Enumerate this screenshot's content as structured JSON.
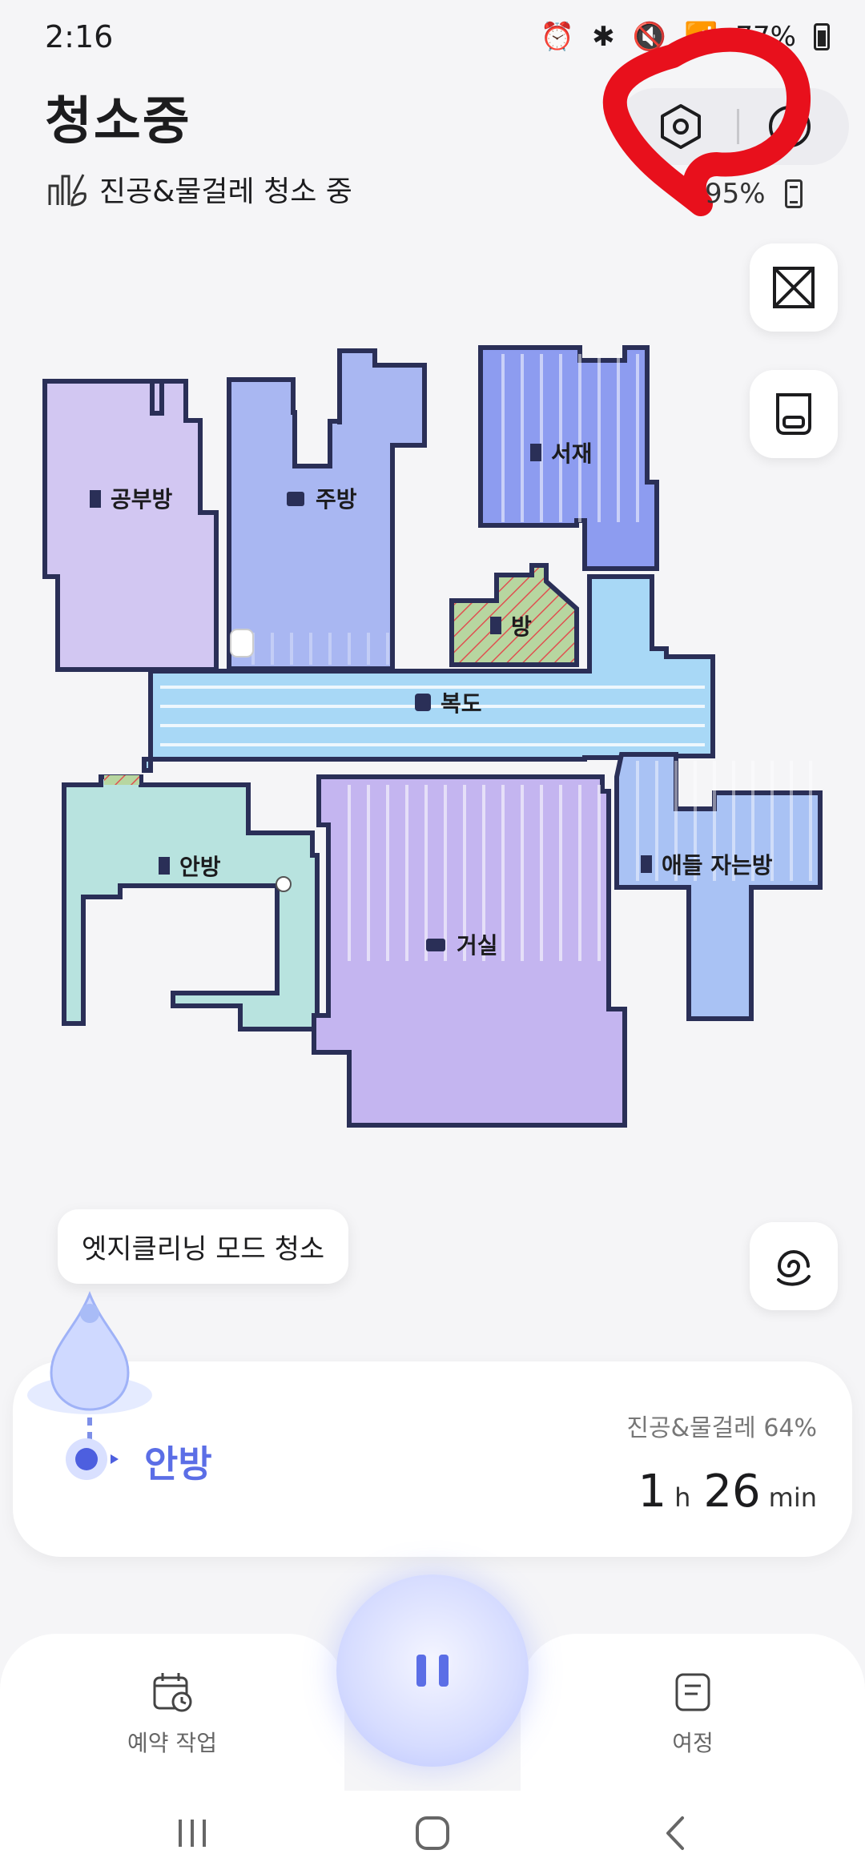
{
  "status_bar": {
    "time": "2:16",
    "battery_text": "77%"
  },
  "header": {
    "title": "청소중",
    "subtitle": "진공&물걸레 청소 중",
    "battery_percent": "95%"
  },
  "map": {
    "rooms": [
      {
        "key": "study",
        "label": "공부방"
      },
      {
        "key": "kitchen",
        "label": "주방"
      },
      {
        "key": "library",
        "label": "서재"
      },
      {
        "key": "room",
        "label": "방"
      },
      {
        "key": "hallway",
        "label": "복도"
      },
      {
        "key": "master",
        "label": "안방"
      },
      {
        "key": "living",
        "label": "거실"
      },
      {
        "key": "kids",
        "label": "애들 자는방"
      }
    ]
  },
  "tooltip": "엣지클리닝 모드 청소",
  "progress_card": {
    "current_room": "안방",
    "mode_label": "진공&물걸레 64%",
    "hours": "1",
    "hours_unit": "h",
    "minutes": "26",
    "minutes_unit": "min"
  },
  "bottom_nav": {
    "schedule_label": "예약 작업",
    "trip_label": "여정"
  },
  "colors": {
    "accent": "#5b6ee6",
    "annotation": "#e8101c",
    "study": "#d2c7f2",
    "kitchen": "#a9b7f2",
    "hallway": "#a8d8f6",
    "master": "#b8e3df",
    "living": "#c4b5f0",
    "kids": "#a9c2f4"
  }
}
